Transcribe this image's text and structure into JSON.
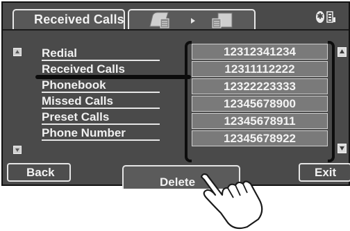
{
  "header": {
    "title": "Received Calls",
    "source_icons": [
      "phone-icon",
      "arrow-right-icon",
      "device-icon"
    ],
    "status_icons": [
      "bluetooth-icon",
      "battery-icon"
    ]
  },
  "menu": {
    "items": [
      {
        "label": "Redial"
      },
      {
        "label": "Received Calls",
        "selected": true
      },
      {
        "label": "Phonebook"
      },
      {
        "label": "Missed Calls"
      },
      {
        "label": "Preset Calls"
      },
      {
        "label": "Phone Number"
      }
    ]
  },
  "numbers": [
    "12312341234",
    "12311112222",
    "12322223333",
    "12345678900",
    "12345678911",
    "12345678922"
  ],
  "buttons": {
    "back": "Back",
    "delete": "Delete",
    "exit": "Exit"
  },
  "colors": {
    "screen_bg": "#4a4a4a",
    "row_bg": "#7a7a7a",
    "text": "#f2f2f2",
    "border": "#e6e6e6"
  }
}
